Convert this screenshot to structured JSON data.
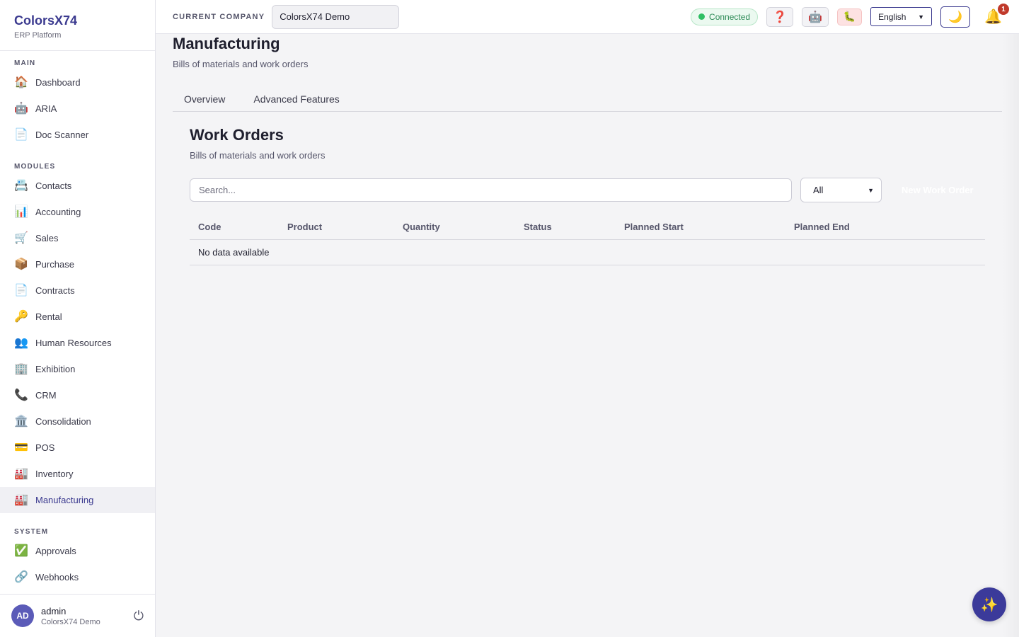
{
  "brand": {
    "name": "ColorsX74",
    "subtitle": "ERP Platform"
  },
  "sidebar": {
    "sections": [
      {
        "title": "MAIN",
        "items": [
          {
            "icon": "🏠",
            "label": "Dashboard"
          },
          {
            "icon": "🤖",
            "label": "ARIA"
          },
          {
            "icon": "📄",
            "label": "Doc Scanner"
          }
        ]
      },
      {
        "title": "MODULES",
        "items": [
          {
            "icon": "📇",
            "label": "Contacts"
          },
          {
            "icon": "📊",
            "label": "Accounting"
          },
          {
            "icon": "🛒",
            "label": "Sales"
          },
          {
            "icon": "📦",
            "label": "Purchase"
          },
          {
            "icon": "📄",
            "label": "Contracts"
          },
          {
            "icon": "🔑",
            "label": "Rental"
          },
          {
            "icon": "👥",
            "label": "Human Resources"
          },
          {
            "icon": "🏢",
            "label": "Exhibition"
          },
          {
            "icon": "📞",
            "label": "CRM"
          },
          {
            "icon": "🏛️",
            "label": "Consolidation"
          },
          {
            "icon": "💳",
            "label": "POS"
          },
          {
            "icon": "🏭",
            "label": "Inventory"
          },
          {
            "icon": "🏭",
            "label": "Manufacturing"
          }
        ]
      },
      {
        "title": "SYSTEM",
        "items": [
          {
            "icon": "✅",
            "label": "Approvals"
          },
          {
            "icon": "🔗",
            "label": "Webhooks"
          }
        ]
      }
    ],
    "active": "Manufacturing"
  },
  "user": {
    "initials": "AD",
    "name": "admin",
    "company": "ColorsX74 Demo",
    "logout_icon": "⏻"
  },
  "header": {
    "company_label": "CURRENT COMPANY",
    "company_value": "ColorsX74 Demo",
    "status": "Connected",
    "help_icon": "❓",
    "robot_icon": "🤖",
    "bug_icon": "🐛",
    "language": "English",
    "theme_icon": "🌙",
    "bell_icon": "🔔",
    "notification_count": "1"
  },
  "page": {
    "title": "Manufacturing",
    "subtitle": "Bills of materials and work orders",
    "tabs": [
      "Overview",
      "Advanced Features"
    ]
  },
  "work_orders": {
    "title": "Work Orders",
    "subtitle": "Bills of materials and work orders",
    "search_placeholder": "Search...",
    "filter_value": "All",
    "new_button": "New Work Order",
    "columns": [
      "Code",
      "Product",
      "Quantity",
      "Status",
      "Planned Start",
      "Planned End"
    ],
    "empty_text": "No data available"
  },
  "fab_icon": "✨",
  "colors": {
    "accent": "#3b3a8f",
    "connected": "#2fbf64",
    "badge": "#c0392b"
  }
}
